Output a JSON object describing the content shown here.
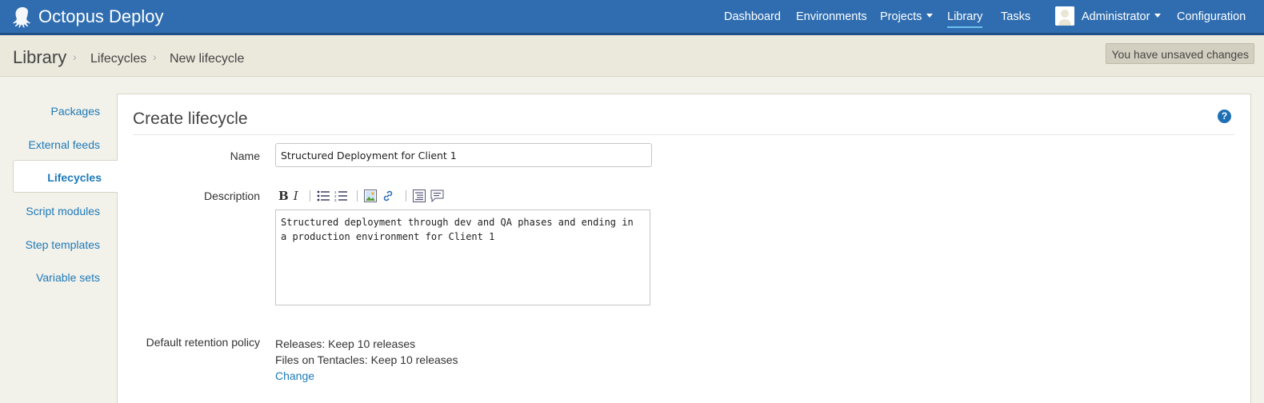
{
  "app": {
    "title": "Octopus Deploy"
  },
  "nav": {
    "dashboard": "Dashboard",
    "environments": "Environments",
    "projects": "Projects",
    "library": "Library",
    "tasks": "Tasks",
    "user": "Administrator",
    "configuration": "Configuration"
  },
  "breadcrumb": {
    "root": "Library",
    "level1": "Lifecycles",
    "level2": "New lifecycle"
  },
  "status": {
    "unsaved": "You have unsaved changes"
  },
  "sidebar": {
    "items": [
      "Packages",
      "External feeds",
      "Lifecycles",
      "Script modules",
      "Step templates",
      "Variable sets"
    ],
    "active": "Lifecycles"
  },
  "form": {
    "title": "Create lifecycle",
    "name_label": "Name",
    "name_value": "Structured Deployment for Client 1",
    "description_label": "Description",
    "description_value": "Structured deployment through dev and QA phases and ending in a production environment for Client 1",
    "retention_label": "Default retention policy",
    "retention_releases": "Releases: Keep 10 releases",
    "retention_tentacles": "Files on Tentacles: Keep 10 releases",
    "retention_change": "Change"
  },
  "colors": {
    "navbar": "#2f6db0",
    "link": "#1f7ab8",
    "background": "#f2f1ea"
  }
}
